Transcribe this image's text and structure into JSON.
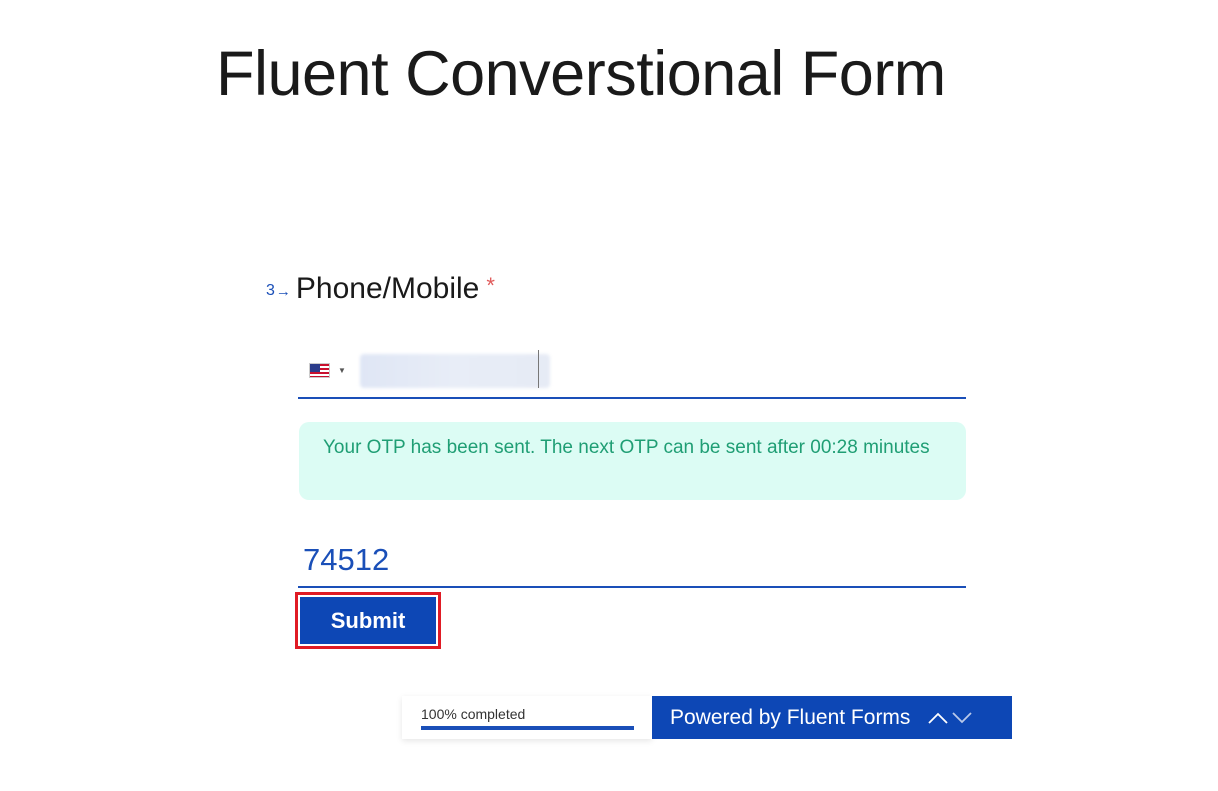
{
  "page": {
    "title": "Fluent Converstional Form"
  },
  "question": {
    "number": "3",
    "label": "Phone/Mobile",
    "required_mark": "*",
    "country_flag": "us-flag-icon",
    "phone_value": ""
  },
  "alert": {
    "message": "Your OTP has been sent. The next OTP can be sent after 00:28 minutes"
  },
  "otp": {
    "value": "74512"
  },
  "submit": {
    "label": "Submit"
  },
  "footer": {
    "progress_text": "100% completed",
    "progress_percent": 100,
    "powered_prefix": "Powered by ",
    "powered_brand": "Fluent Forms",
    "prev_icon": "chevron-up-icon",
    "next_icon": "chevron-down-icon"
  },
  "colors": {
    "accent": "#0d47b5",
    "required": "#e05a5a",
    "alert_bg": "#dcfcf4",
    "alert_text": "#1f9e74",
    "highlight": "#e01b24"
  }
}
